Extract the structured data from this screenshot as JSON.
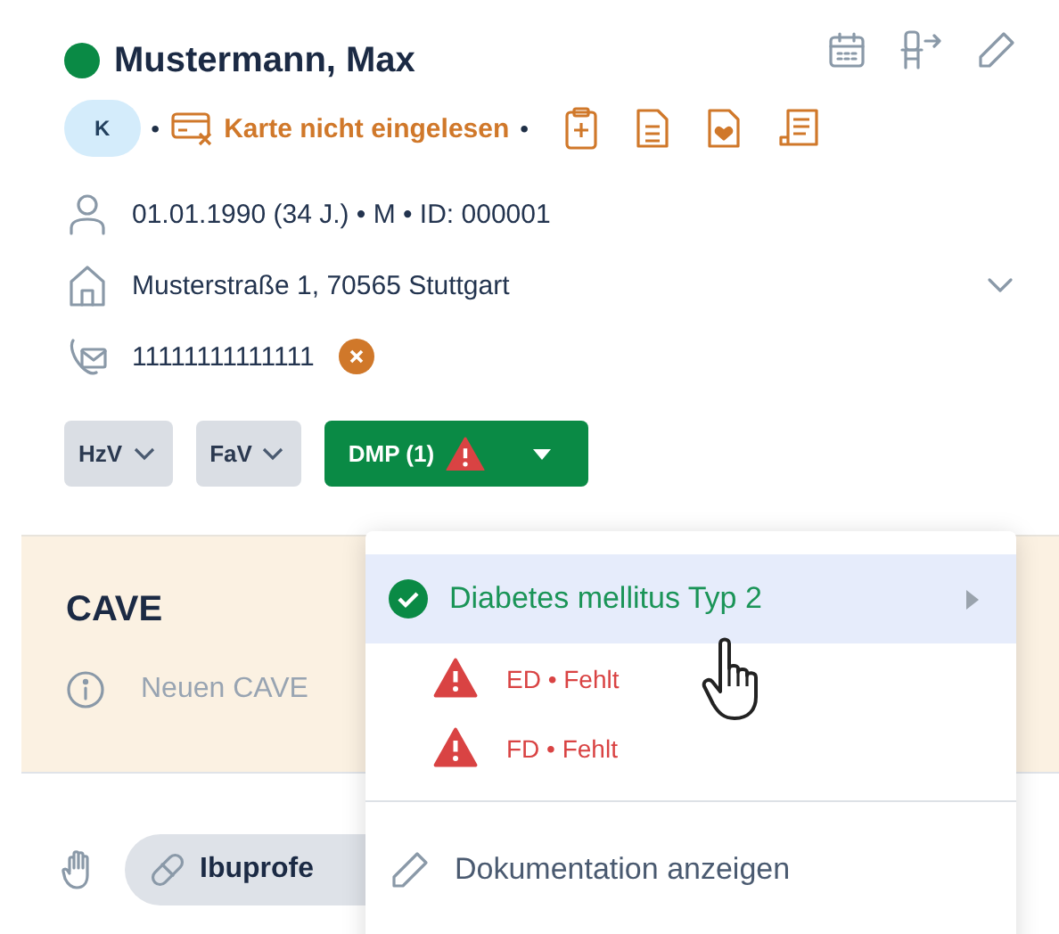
{
  "patient": {
    "name": "Mustermann, Max",
    "insurance_badge": "K",
    "separators": [
      "•",
      "•"
    ],
    "card_status": "Karte nicht eingelesen",
    "birth": "01.01.1990 (34 J.) • M • ID: 000001",
    "address": "Musterstraße 1, 70565 Stuttgart",
    "phone": "11111111111111"
  },
  "programs": [
    {
      "label": "HzV",
      "selected": false,
      "alert": false
    },
    {
      "label": "FaV",
      "selected": false,
      "alert": false
    },
    {
      "label": "DMP (1)",
      "selected": true,
      "alert": true
    }
  ],
  "cave": {
    "title": "CAVE",
    "placeholder": "Neuen CAVE"
  },
  "medication": {
    "label": "Ibuprofe"
  },
  "dmp_menu": {
    "items": [
      {
        "kind": "condition",
        "label": "Diabetes mellitus Typ 2",
        "selected": true
      },
      {
        "kind": "warning",
        "label": "ED • Fehlt",
        "selected": false
      },
      {
        "kind": "warning",
        "label": "FD • Fehlt",
        "selected": false
      }
    ],
    "actions": [
      {
        "label": "Dokumentation anzeigen"
      }
    ]
  }
}
